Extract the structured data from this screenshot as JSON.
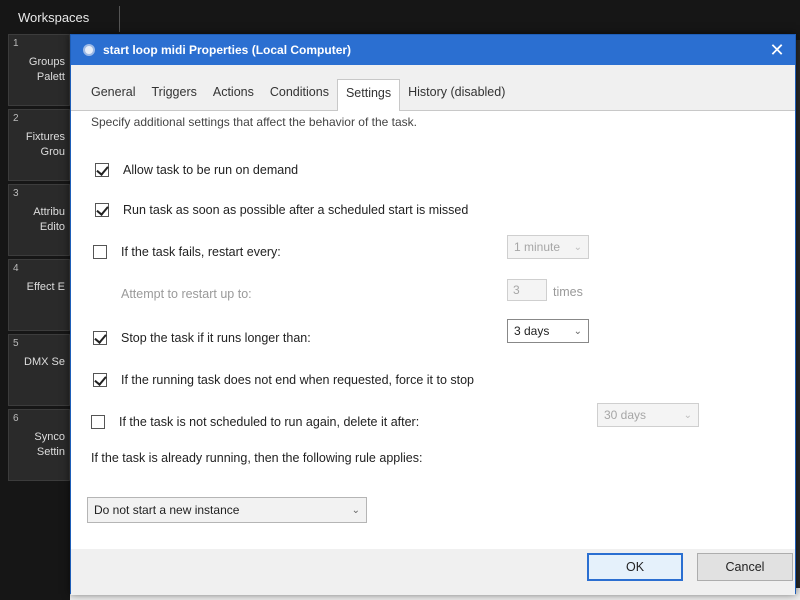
{
  "background_app": {
    "header": "Workspaces",
    "tiles": [
      {
        "num": "1",
        "label": "Groups\nPalett"
      },
      {
        "num": "2",
        "label": "Fixtures\nGrou"
      },
      {
        "num": "3",
        "label": "Attribu\nEdito"
      },
      {
        "num": "4",
        "label": "Effect E"
      },
      {
        "num": "5",
        "label": "DMX Se"
      },
      {
        "num": "6",
        "label": "Synco\nSettin"
      }
    ]
  },
  "dialog": {
    "title": "start loop midi Properties (Local Computer)",
    "close_glyph": "✕",
    "tabs": [
      {
        "label": "General",
        "active": false
      },
      {
        "label": "Triggers",
        "active": false
      },
      {
        "label": "Actions",
        "active": false
      },
      {
        "label": "Conditions",
        "active": false
      },
      {
        "label": "Settings",
        "active": true
      },
      {
        "label": "History (disabled)",
        "active": false
      }
    ],
    "description": "Specify additional settings that affect the behavior of the task.",
    "settings": {
      "allow_on_demand": {
        "label": "Allow task to be run on demand",
        "checked": true
      },
      "run_asap": {
        "label": "Run task as soon as possible after a scheduled start is missed",
        "checked": true
      },
      "restart_on_fail": {
        "label": "If the task fails, restart every:",
        "checked": false,
        "interval": "1 minute"
      },
      "restart_attempts": {
        "label": "Attempt to restart up to:",
        "value": "3",
        "unit": "times"
      },
      "stop_if_longer": {
        "label": "Stop the task if it runs longer than:",
        "checked": true,
        "duration": "3 days"
      },
      "force_stop": {
        "label": "If the running task does not end when requested, force it to stop",
        "checked": true
      },
      "delete_if_not_scheduled": {
        "label": "If the task is not scheduled to run again, delete it after:",
        "checked": false,
        "duration": "30 days"
      },
      "running_rule_label": "If the task is already running, then the following rule applies:",
      "running_rule_value": "Do not start a new instance"
    },
    "buttons": {
      "ok": "OK",
      "cancel": "Cancel"
    },
    "colors": {
      "titlebar": "#2b6fd1",
      "content_bg": "#ffffff",
      "dialog_bg": "#f0f0f0"
    }
  }
}
